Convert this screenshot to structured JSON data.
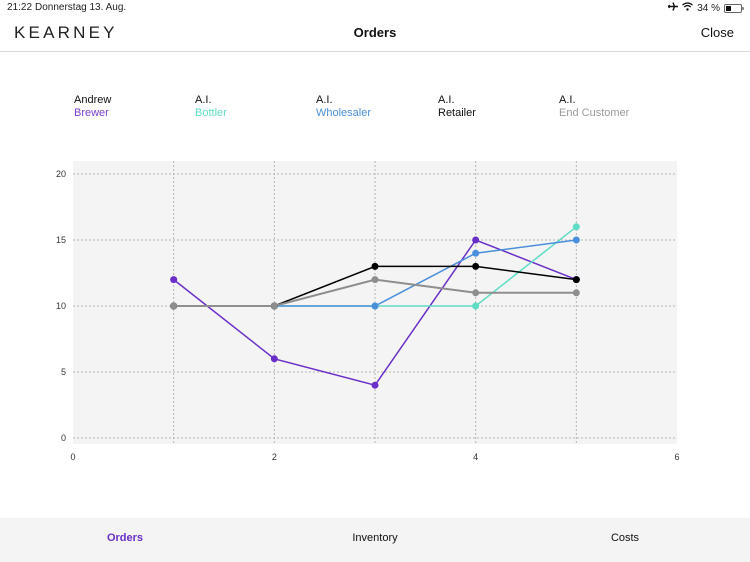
{
  "status_bar": {
    "time": "21:22",
    "date": "Donnerstag 13. Aug.",
    "battery_percent": "34 %",
    "icons": [
      "airplane-icon",
      "wifi-icon",
      "battery-icon"
    ]
  },
  "nav": {
    "logo": "KEARNEY",
    "title": "Orders",
    "close_label": "Close"
  },
  "legend": [
    {
      "owner": "Andrew",
      "role": "Brewer",
      "color": "#7b3fd1"
    },
    {
      "owner": "A.I.",
      "role": "Bottler",
      "color": "#5fdcc4"
    },
    {
      "owner": "A.I.",
      "role": "Wholesaler",
      "color": "#4a90d9"
    },
    {
      "owner": "A.I.",
      "role": "Retailer",
      "color": "#111111"
    },
    {
      "owner": "A.I.",
      "role": "End Customer",
      "color": "#9a9a9a"
    }
  ],
  "chart_data": {
    "type": "line",
    "title": "",
    "xlabel": "",
    "ylabel": "",
    "xlim": [
      0,
      6
    ],
    "ylim": [
      0,
      20
    ],
    "x_ticks": [
      "0",
      "2",
      "4",
      "6"
    ],
    "y_ticks": [
      "0",
      "5",
      "10",
      "15",
      "20"
    ],
    "grid": true,
    "x": [
      1,
      2,
      3,
      4,
      5
    ],
    "series": [
      {
        "name": "Brewer",
        "color": "#6a2fc8",
        "values": [
          12,
          6,
          4,
          15,
          12
        ]
      },
      {
        "name": "Bottler",
        "color": "#5fdcc4",
        "values": [
          10,
          10,
          10,
          10,
          16
        ]
      },
      {
        "name": "Wholesaler",
        "color": "#4a8fdc",
        "values": [
          10,
          10,
          10,
          14,
          15
        ]
      },
      {
        "name": "Retailer",
        "color": "#000000",
        "values": [
          10,
          10,
          13,
          13,
          12
        ]
      },
      {
        "name": "End Customer",
        "color": "#8e8e8e",
        "values": [
          10,
          10,
          12,
          11,
          11
        ]
      }
    ]
  },
  "tabs": [
    {
      "label": "Orders",
      "active": true
    },
    {
      "label": "Inventory",
      "active": false
    },
    {
      "label": "Costs",
      "active": false
    }
  ],
  "colors": {
    "accent": "#6a2fc8",
    "plot_background": "#f4f4f4",
    "tab_bar_background": "#f4f4f4"
  }
}
